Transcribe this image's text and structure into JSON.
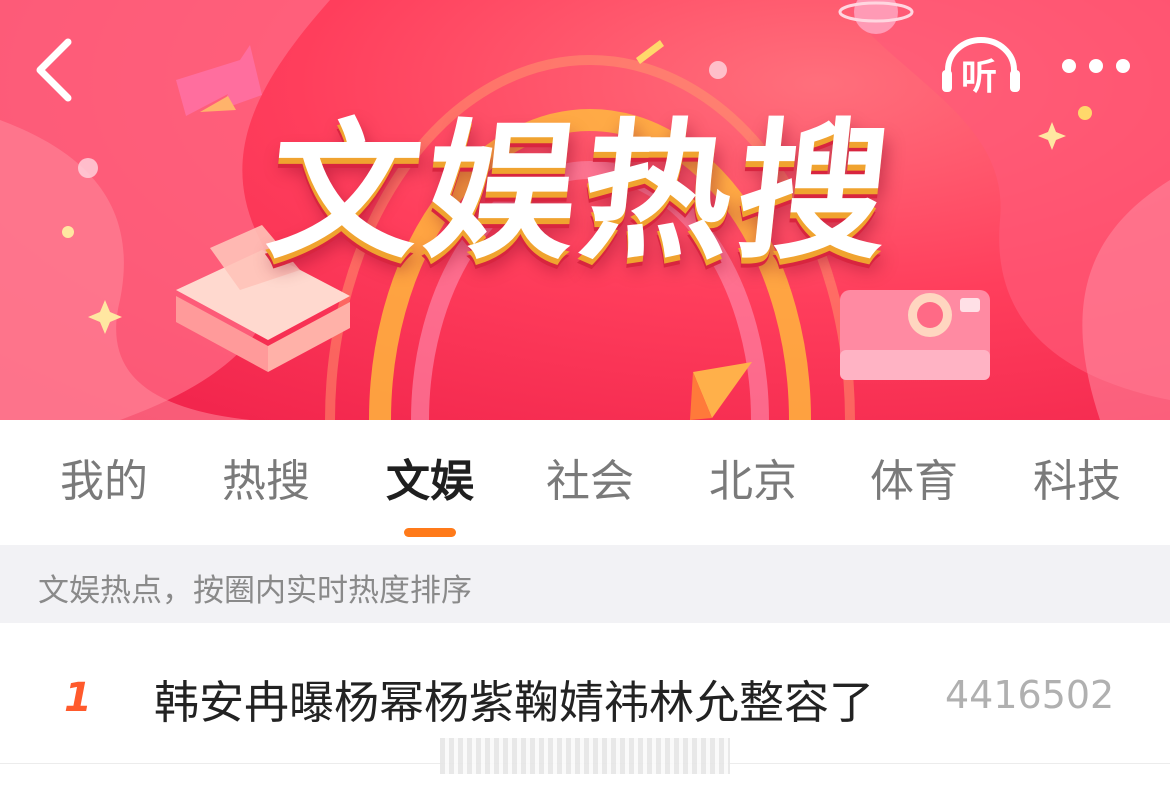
{
  "header": {
    "banner_title": "文娱热搜",
    "listen_label": "听"
  },
  "tabs": [
    {
      "label": "我的"
    },
    {
      "label": "热搜"
    },
    {
      "label": "文娱",
      "active": true
    },
    {
      "label": "社会"
    },
    {
      "label": "北京"
    },
    {
      "label": "体育"
    },
    {
      "label": "科技"
    }
  ],
  "subtitle": "文娱热点，按圈内实时热度排序",
  "list": [
    {
      "rank": "1",
      "title": "韩安冉曝杨幂杨紫鞠婧祎林允整容了",
      "heat": "4416502"
    }
  ],
  "colors": {
    "banner_red": "#ee1e48",
    "accent_orange": "#ff7a1a",
    "rank_orange": "#ff5a2c"
  },
  "icons": [
    "back-chevron-icon",
    "listen-headphone-icon",
    "more-dots-icon"
  ]
}
